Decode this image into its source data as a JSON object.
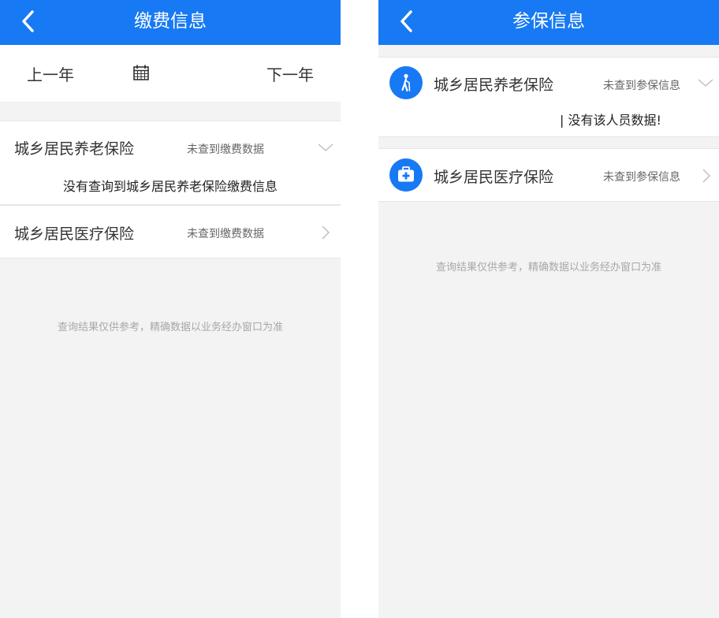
{
  "left_screen": {
    "nav": {
      "title": "缴费信息",
      "back_icon": "chevron-left-icon"
    },
    "year_bar": {
      "prev_label": "上一年",
      "next_label": "下一年",
      "calendar_icon": "calendar-icon"
    },
    "items": [
      {
        "title": "城乡居民养老保险",
        "status": "未查到缴费数据",
        "expanded": true,
        "message": "没有查询到城乡居民养老保险缴费信息",
        "chevron": "chevron-down-icon"
      },
      {
        "title": "城乡居民医疗保险",
        "status": "未查到缴费数据",
        "expanded": false,
        "chevron": "chevron-right-icon"
      }
    ],
    "footer_note": "查询结果仅供参考，精确数据以业务经办窗口为准"
  },
  "right_screen": {
    "nav": {
      "title": "参保信息",
      "back_icon": "chevron-left-icon"
    },
    "items": [
      {
        "title": "城乡居民养老保险",
        "status": "未查到参保信息",
        "expanded": true,
        "message": "| 没有该人员数据!",
        "icon": "elderly-person-icon",
        "chevron": "chevron-down-icon"
      },
      {
        "title": "城乡居民医疗保险",
        "status": "未查到参保信息",
        "expanded": false,
        "icon": "medical-kit-icon",
        "chevron": "chevron-right-icon"
      }
    ],
    "footer_note": "查询结果仅供参考，精确数据以业务经办窗口为准"
  },
  "colors": {
    "brand_blue": "#1779f3",
    "background_gray": "#f3f3f4",
    "text_dark": "#333333",
    "text_muted": "#666666",
    "note_gray": "#a8a8a8"
  }
}
